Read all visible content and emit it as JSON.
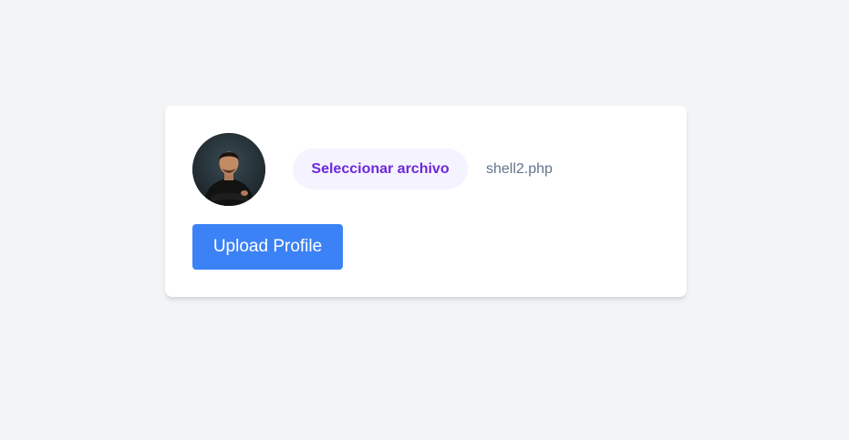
{
  "profile_form": {
    "avatar": {
      "description_icon": "user-photo"
    },
    "file_input": {
      "button_label": "Seleccionar archivo",
      "selected_file": "shell2.php"
    },
    "upload_button_label": "Upload Profile"
  },
  "colors": {
    "page_background": "#f3f4f6",
    "card_background": "#ffffff",
    "file_button_background": "#f5f3ff",
    "file_button_text": "#6d28d9",
    "file_name_text": "#64748b",
    "upload_button_background": "#3b82f6",
    "upload_button_text": "#ffffff"
  }
}
